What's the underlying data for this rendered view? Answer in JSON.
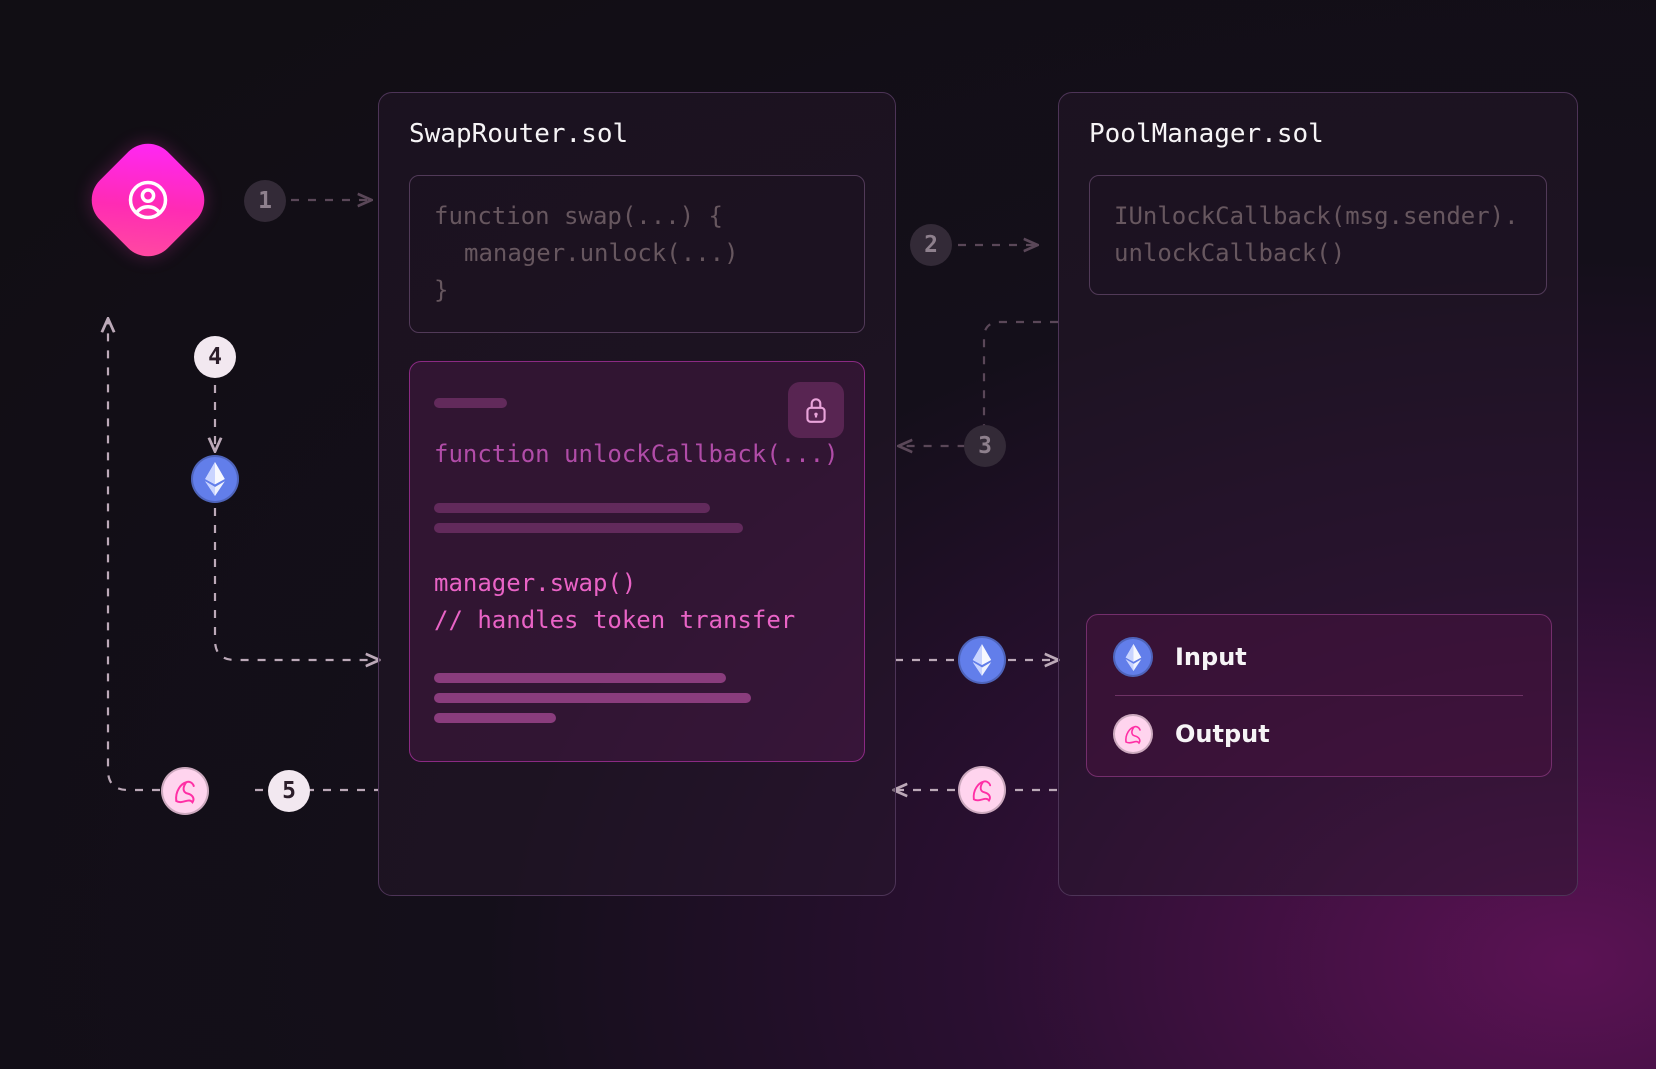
{
  "steps": {
    "s1": "1",
    "s2": "2",
    "s3": "3",
    "s4": "4",
    "s5": "5"
  },
  "swapRouter": {
    "title": "SwapRouter.sol",
    "swap_fn_open": "function swap(...) {",
    "swap_fn_body": "manager.unlock(...)",
    "swap_fn_close": "}",
    "callback_sig": "function unlockCallback(...)",
    "callback_call": "manager.swap()",
    "callback_comment": "// handles token transfer"
  },
  "poolManager": {
    "title": "PoolManager.sol",
    "code_line1": "IUnlockCallback(msg.sender).",
    "code_line2": "unlockCallback()",
    "input_label": "Input",
    "output_label": "Output"
  },
  "tokens": {
    "eth": "ethereum-icon",
    "uni": "uniswap-icon"
  }
}
